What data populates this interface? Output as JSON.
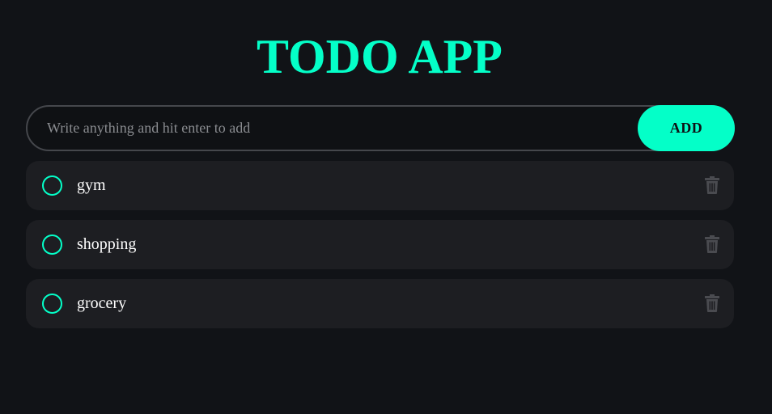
{
  "app": {
    "title": "TODO APP"
  },
  "input": {
    "placeholder": "Write anything and hit enter to add",
    "value": "",
    "add_label": "ADD"
  },
  "todos": [
    {
      "text": "gym",
      "completed": false
    },
    {
      "text": "shopping",
      "completed": false
    },
    {
      "text": "grocery",
      "completed": false
    }
  ],
  "icons": {
    "check": "circle-check-icon",
    "delete": "trash-icon"
  },
  "colors": {
    "background": "#111317",
    "accent": "#04ffc8",
    "item_background": "#1d1e22",
    "text": "#ffffff",
    "placeholder": "#8a8c90",
    "trash": "#4a4b50"
  }
}
